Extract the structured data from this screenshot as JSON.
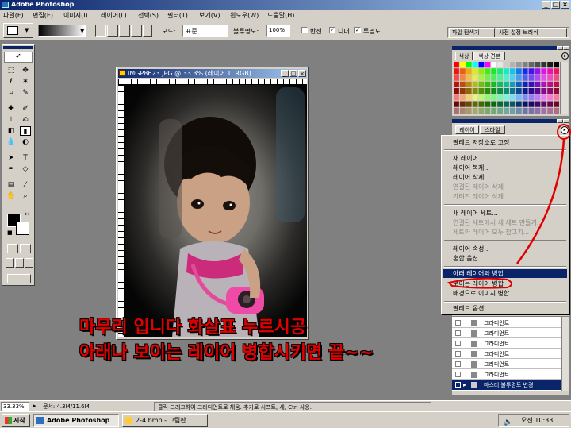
{
  "window": {
    "title": "Adobe Photoshop"
  },
  "menu": [
    "파일(F)",
    "편집(E)",
    "이미지(I)",
    "레이어(L)",
    "선택(S)",
    "필터(T)",
    "보기(V)",
    "윈도우(W)",
    "도움말(H)"
  ],
  "options": {
    "mode_label": "모드:",
    "mode_value": "표준",
    "opacity_label": "불투명도:",
    "opacity_value": "100%",
    "reverse_label": "반전",
    "dither_label": "디더",
    "transparency_label": "투명도"
  },
  "palette_tabs": {
    "file_browser": "파일 탐색기",
    "brushes": "사전 설정 브러쉬"
  },
  "document": {
    "title": "IMGP8623.JPG @ 33.3% (레이어 1, RGB)"
  },
  "swatches": {
    "tab_color": "색상",
    "tab_swatches": "색상 견본"
  },
  "layers": {
    "tab_layers": "레이어",
    "tab_styles": "스타일",
    "rows": [
      "그라디언트",
      "그라디언트",
      "그라디언트",
      "그라디언트",
      "그라디언트",
      "그라디언트"
    ],
    "last_row": "마스터 불투명도 변경"
  },
  "popup": {
    "items": [
      {
        "label": "팔레트 저장소로 고정",
        "disabled": false
      },
      {
        "label": "새 레이어...",
        "disabled": false
      },
      {
        "label": "레이어 복제...",
        "disabled": false
      },
      {
        "label": "레이어 삭제",
        "disabled": false
      },
      {
        "label": "연결된 레이어 삭제",
        "disabled": true
      },
      {
        "label": "가려진 레이어 삭제",
        "disabled": true
      },
      {
        "label": "새 레이어 세트...",
        "disabled": false
      },
      {
        "label": "연결된 세트에서 새 세트 만들기...",
        "disabled": true
      },
      {
        "label": "세트와 레이어 모두 잠그기...",
        "disabled": true
      },
      {
        "label": "레이어 속성...",
        "disabled": false
      },
      {
        "label": "혼합 옵션...",
        "disabled": false
      },
      {
        "label": "아래 레이어와 병합",
        "disabled": false,
        "highlighted": true
      },
      {
        "label": "보이는 레이어 병합",
        "disabled": false
      },
      {
        "label": "배경으로 이미지 병합",
        "disabled": false
      },
      {
        "label": "팔레트 옵션...",
        "disabled": false
      }
    ]
  },
  "caption": {
    "line1": "마무리 입니다 화살표 누르시공",
    "line2": "아래나 보이는 레이어 병합시키면 끝~~"
  },
  "status": {
    "zoom": "33.33%",
    "doc": "문서: 4.3M/11.6M",
    "hint": "클릭-드래그하여 그라디언트로 채움. 추가로 시프트, 새, Ctrl 사용."
  },
  "taskbar": {
    "start": "시작",
    "task1": "Adobe Photoshop",
    "task2": "2-4.bmp - 그림판",
    "clock": "오전 10:33"
  },
  "colors": {
    "titlebar": "#0a246a",
    "highlight": "#0a246a",
    "annotation_red": "#e00000"
  }
}
